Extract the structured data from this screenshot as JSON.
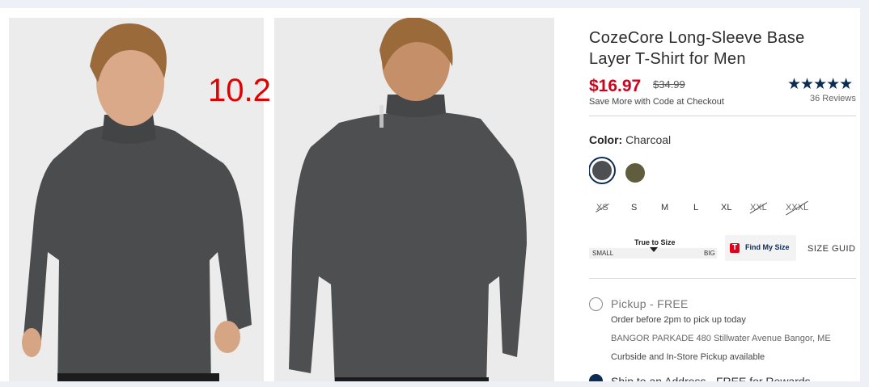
{
  "overlay_number": "10.2",
  "product": {
    "title": "CozeCore Long-Sleeve Base Layer T-Shirt for Men",
    "price": "$16.97",
    "original_price": "$34.99",
    "promo_note": "Save More with Code at Checkout",
    "rating_stars": "★★★★★",
    "rating": 4.5,
    "review_count": "36 Reviews"
  },
  "color": {
    "label": "Color:",
    "selected": "Charcoal",
    "swatches": [
      {
        "name": "Charcoal",
        "hex": "#4d4f52",
        "selected": true
      },
      {
        "name": "Olive",
        "hex": "#5f5d3e",
        "selected": false
      }
    ]
  },
  "sizes": [
    {
      "label": "XS",
      "available": false
    },
    {
      "label": "S",
      "available": true
    },
    {
      "label": "M",
      "available": true
    },
    {
      "label": "L",
      "available": true
    },
    {
      "label": "XL",
      "available": true
    },
    {
      "label": "XXL",
      "available": false
    },
    {
      "label": "XXXL",
      "available": false
    }
  ],
  "fit": {
    "title": "True to Size",
    "small": "SMALL",
    "big": "BIG"
  },
  "find_my_size": {
    "badge": "T",
    "label": "Find My Size"
  },
  "size_guide": "SIZE GUIDE",
  "fulfillment": {
    "pickup": {
      "label": "Pickup - FREE",
      "note": "Order before 2pm to pick up today",
      "store": "BANGOR PARKADE 480 Stillwater Avenue  Bangor, ME",
      "availability": "Curbside and In-Store Pickup available",
      "selected": false
    },
    "ship": {
      "label": "Ship to an Address - FREE for Rewards",
      "selected": true
    }
  },
  "colors": {
    "price_red": "#d0021b",
    "navy": "#0d2c54"
  }
}
